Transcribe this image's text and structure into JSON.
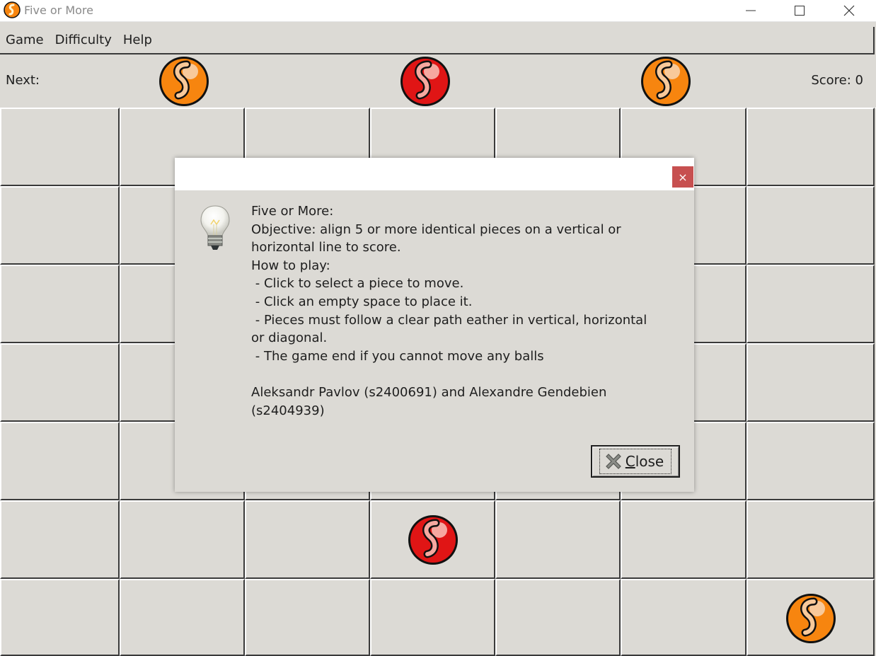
{
  "window": {
    "title": "Five or More"
  },
  "menu": {
    "items": [
      "Game",
      "Difficulty",
      "Help"
    ]
  },
  "next": {
    "label": "Next:",
    "balls": [
      {
        "color": "orange"
      },
      {
        "color": "red"
      },
      {
        "color": "orange"
      }
    ]
  },
  "score": {
    "text": "Score: 0"
  },
  "board": {
    "rows": 7,
    "cols": 7,
    "pieces": [
      {
        "row": 5,
        "col": 3,
        "color": "red"
      },
      {
        "row": 6,
        "col": 6,
        "color": "orange"
      }
    ]
  },
  "colors": {
    "orange": "#f7850f",
    "red": "#e01515",
    "close_red": "#c75050"
  },
  "dialog": {
    "lines": [
      "Five or More:",
      "Objective: align 5 or more identical pieces on a vertical or",
      "horizontal line to score.",
      "How to play:",
      " - Click to select a piece to move.",
      " - Click an empty space to place it.",
      " - Pieces must follow a clear path eather in vertical, horizontal",
      "or diagonal.",
      " - The game end if you cannot move any balls",
      "",
      "Aleksandr Pavlov (s2400691) and Alexandre Gendebien",
      "(s2404939)"
    ],
    "close_label_first": "C",
    "close_label_rest": "lose",
    "close_x": "×"
  }
}
